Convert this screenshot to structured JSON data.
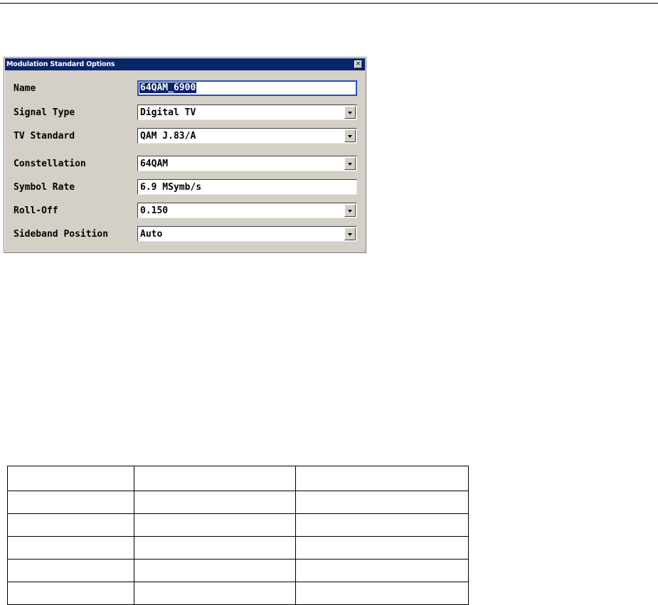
{
  "dialog": {
    "title": "Modulation Standard Options",
    "close_glyph": "×",
    "fields": [
      {
        "label": "Name",
        "value": "64QAM_6900",
        "kind": "text",
        "focused": true
      },
      {
        "label": "Signal Type",
        "value": "Digital TV",
        "kind": "dropdown"
      },
      {
        "label": "TV Standard",
        "value": "QAM J.83/A",
        "kind": "dropdown"
      },
      {
        "label": "Constellation",
        "value": "64QAM",
        "kind": "dropdown"
      },
      {
        "label": "Symbol Rate",
        "value": "6.9 MSymb/s",
        "kind": "text"
      },
      {
        "label": "Roll-Off",
        "value": "0.150",
        "kind": "dropdown"
      },
      {
        "label": "Sideband Position",
        "value": "Auto",
        "kind": "dropdown"
      }
    ]
  },
  "table": {
    "rows": [
      [
        "",
        "",
        ""
      ],
      [
        "",
        "",
        ""
      ],
      [
        "",
        "",
        ""
      ],
      [
        "",
        "",
        ""
      ],
      [
        "",
        "",
        ""
      ],
      [
        "",
        "",
        ""
      ]
    ]
  },
  "colors": {
    "title_bar": "#0a246a",
    "dialog_face": "#d4d0c8",
    "focus_border": "#2850b8"
  }
}
